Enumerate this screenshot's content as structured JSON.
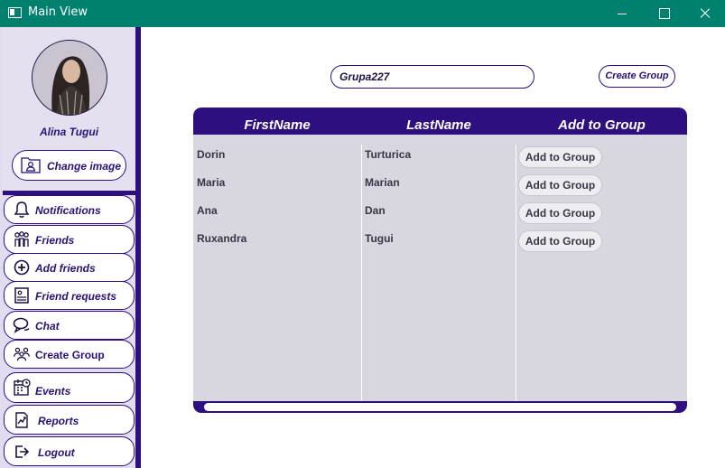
{
  "window": {
    "title": "Main View"
  },
  "profile": {
    "name": "Alina Tugui",
    "change_image_label": "Change image"
  },
  "nav": [
    {
      "label": "Notifications",
      "icon": "bell-icon"
    },
    {
      "label": "Friends",
      "icon": "friends-icon"
    },
    {
      "label": "Add friends",
      "icon": "plus-circle-icon"
    },
    {
      "label": "Friend requests",
      "icon": "request-document-icon"
    },
    {
      "label": "Chat",
      "icon": "chat-bubble-icon"
    },
    {
      "label": "Create Group",
      "icon": "group-icon"
    },
    {
      "label": "Events",
      "icon": "calendar-clock-icon"
    },
    {
      "label": "Reports",
      "icon": "report-chart-icon"
    },
    {
      "label": "Logout",
      "icon": "logout-icon"
    }
  ],
  "group": {
    "name_value": "Grupa227",
    "create_label": "Create Group"
  },
  "table": {
    "headers": [
      "FirstName",
      "LastName",
      "Add to Group"
    ],
    "rows": [
      {
        "first": "Dorin",
        "last": "Turturica",
        "action": "Add to Group"
      },
      {
        "first": "Maria",
        "last": "Marian",
        "action": "Add to Group"
      },
      {
        "first": "Ana",
        "last": "Dan",
        "action": "Add to Group"
      },
      {
        "first": "Ruxandra",
        "last": "Tugui",
        "action": "Add to Group"
      }
    ]
  },
  "colors": {
    "titlebar": "#00816f",
    "accent": "#2e0f80",
    "sidebar_bg": "#e2dcf0",
    "table_bg": "#d8d7e0"
  }
}
